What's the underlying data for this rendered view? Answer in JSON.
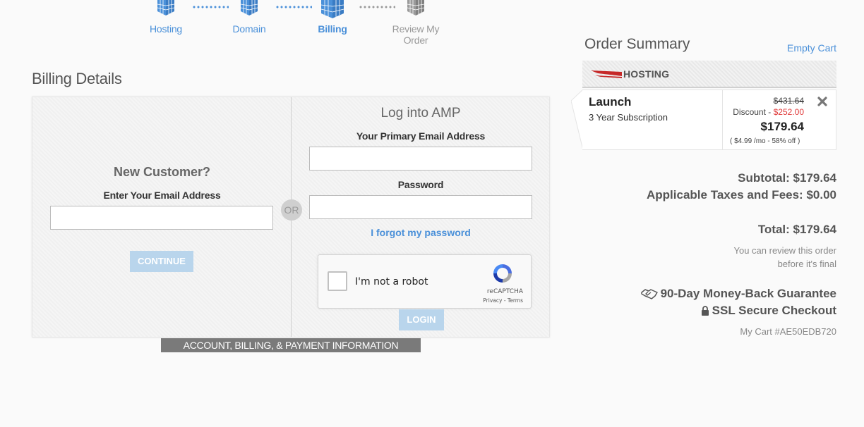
{
  "steps": [
    {
      "label": "Hosting",
      "state": "done"
    },
    {
      "label": "Domain",
      "state": "done"
    },
    {
      "label": "Billing",
      "state": "active"
    },
    {
      "label": "Review My Order",
      "state": "inactive"
    }
  ],
  "billing": {
    "title": "Billing Details",
    "new_customer": {
      "title": "New Customer?",
      "email_label": "Enter Your Email Address",
      "email_value": "",
      "continue_label": "CONTINUE"
    },
    "or_label": "OR",
    "login": {
      "title": "Log into AMP",
      "email_label": "Your Primary Email Address",
      "email_value": "",
      "password_label": "Password",
      "password_value": "",
      "forgot_label": "I forgot my password",
      "login_label": "LOGIN"
    },
    "recaptcha": {
      "label": "I'm not a robot",
      "brand": "reCAPTCHA",
      "terms": "Privacy - Terms"
    },
    "footer_bar": "ACCOUNT, BILLING, & PAYMENT INFORMATION"
  },
  "order_summary": {
    "title": "Order Summary",
    "empty_cart": "Empty Cart",
    "category": "HOSTING",
    "item": {
      "name": "Launch",
      "subscription": "3 Year Subscription",
      "original_price": "$431.64",
      "discount_label": "Discount - ",
      "discount_amount": "$252.00",
      "final_price": "$179.64",
      "per_month": "( $4.99 /mo - 58% off )"
    },
    "subtotal": "Subtotal: $179.64",
    "taxes": "Applicable Taxes and Fees: $0.00",
    "total": "Total: $179.64",
    "review_note_1": "You can review this order",
    "review_note_2": "before it's final",
    "guarantee": "90-Day Money-Back Guarantee",
    "ssl": "SSL Secure Checkout",
    "cart_id": "My Cart #AE50EDB720"
  },
  "colors": {
    "accent": "#4a90d9",
    "discount": "#e03a3a",
    "button_light": "#b9d5ec",
    "footer_bar": "#7a7a7a"
  }
}
